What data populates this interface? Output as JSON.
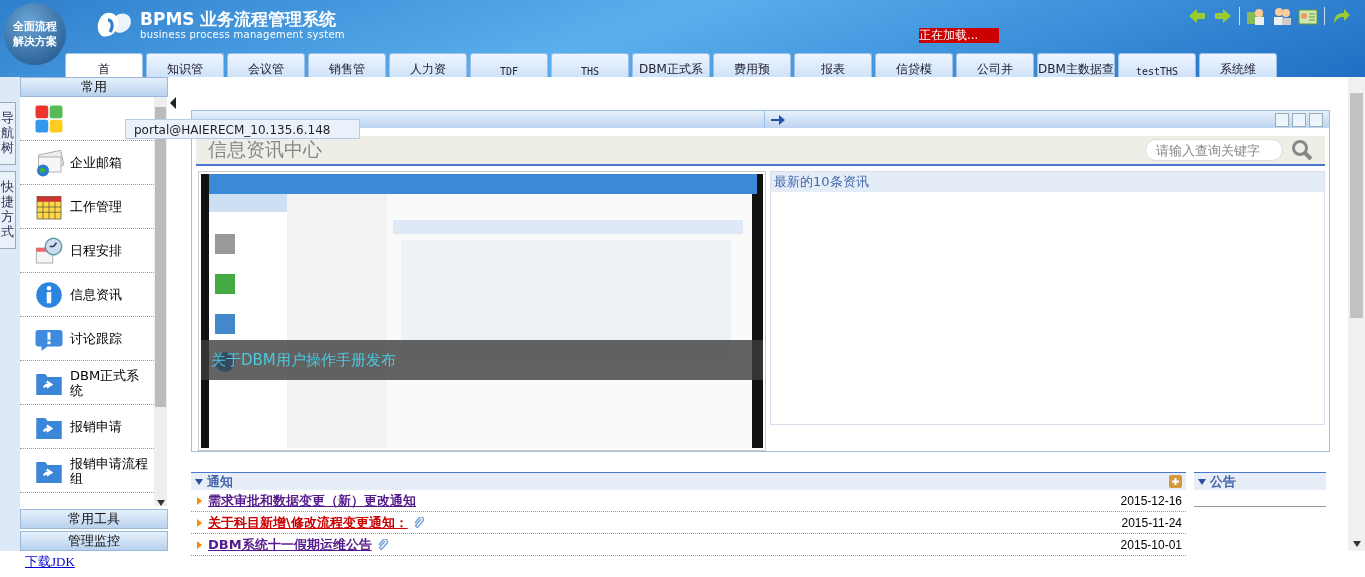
{
  "header": {
    "badge_lines": [
      "全面流程",
      "解决方案"
    ],
    "logo_title": "BPMS 业务流程管理系统",
    "logo_subtitle": "business process management system",
    "loading": "正在加载..."
  },
  "nav_tabs": [
    {
      "label": "首",
      "selected": true
    },
    {
      "label": "知识管",
      "selected": false
    },
    {
      "label": "会议管",
      "selected": false
    },
    {
      "label": "销售管",
      "selected": false
    },
    {
      "label": "人力资",
      "selected": false
    },
    {
      "label": "TDF",
      "selected": false
    },
    {
      "label": "THS",
      "selected": false
    },
    {
      "label": "DBM正式系",
      "selected": false
    },
    {
      "label": "费用预",
      "selected": false
    },
    {
      "label": "报表",
      "selected": false
    },
    {
      "label": "信贷模",
      "selected": false
    },
    {
      "label": "公司并",
      "selected": false
    },
    {
      "label": "DBM主数据查",
      "selected": false
    },
    {
      "label": "testTHS",
      "selected": false
    },
    {
      "label": "系统维",
      "selected": false
    }
  ],
  "side_tabs": [
    {
      "label": "导航树"
    },
    {
      "label": "快捷方式"
    }
  ],
  "sidebar": {
    "header": "常用",
    "items": [
      {
        "kind": "tiles"
      },
      {
        "kind": "mail",
        "label": "企业邮箱"
      },
      {
        "kind": "calendar",
        "label": "工作管理"
      },
      {
        "kind": "clock",
        "label": "日程安排"
      },
      {
        "kind": "info",
        "label": "信息资讯"
      },
      {
        "kind": "chat",
        "label": "讨论跟踪"
      },
      {
        "kind": "folder",
        "label": "DBM正式系统"
      },
      {
        "kind": "folder",
        "label": "报销申请"
      },
      {
        "kind": "folder",
        "label": "报销申请流程组"
      }
    ],
    "sections": [
      "常用工具",
      "管理监控"
    ]
  },
  "tooltip": "portal@HAIERECM_10.135.6.148",
  "portal": {
    "title": "信息资讯中心",
    "search": {
      "placeholder": "请输入查询关键字"
    },
    "slide": {
      "kind": "picture",
      "caption": "关于DBM用户操作手册发布"
    },
    "latest": {
      "title": "最新的10条资讯"
    }
  },
  "notices": {
    "title": "通知",
    "items": [
      {
        "title": "需求审批和数据变更（新）更改通知",
        "date": "2015-12-16",
        "attachment": false,
        "highlight": false
      },
      {
        "title": "关于科目新增\\修改流程变更通知：",
        "date": "2015-11-24",
        "attachment": true,
        "highlight": true
      },
      {
        "title": "DBM系统十一假期运维公告",
        "date": "2015-10-01",
        "attachment": true,
        "highlight": false
      }
    ]
  },
  "announcements": {
    "title": "公告"
  },
  "footer_link": "下载JDK"
}
